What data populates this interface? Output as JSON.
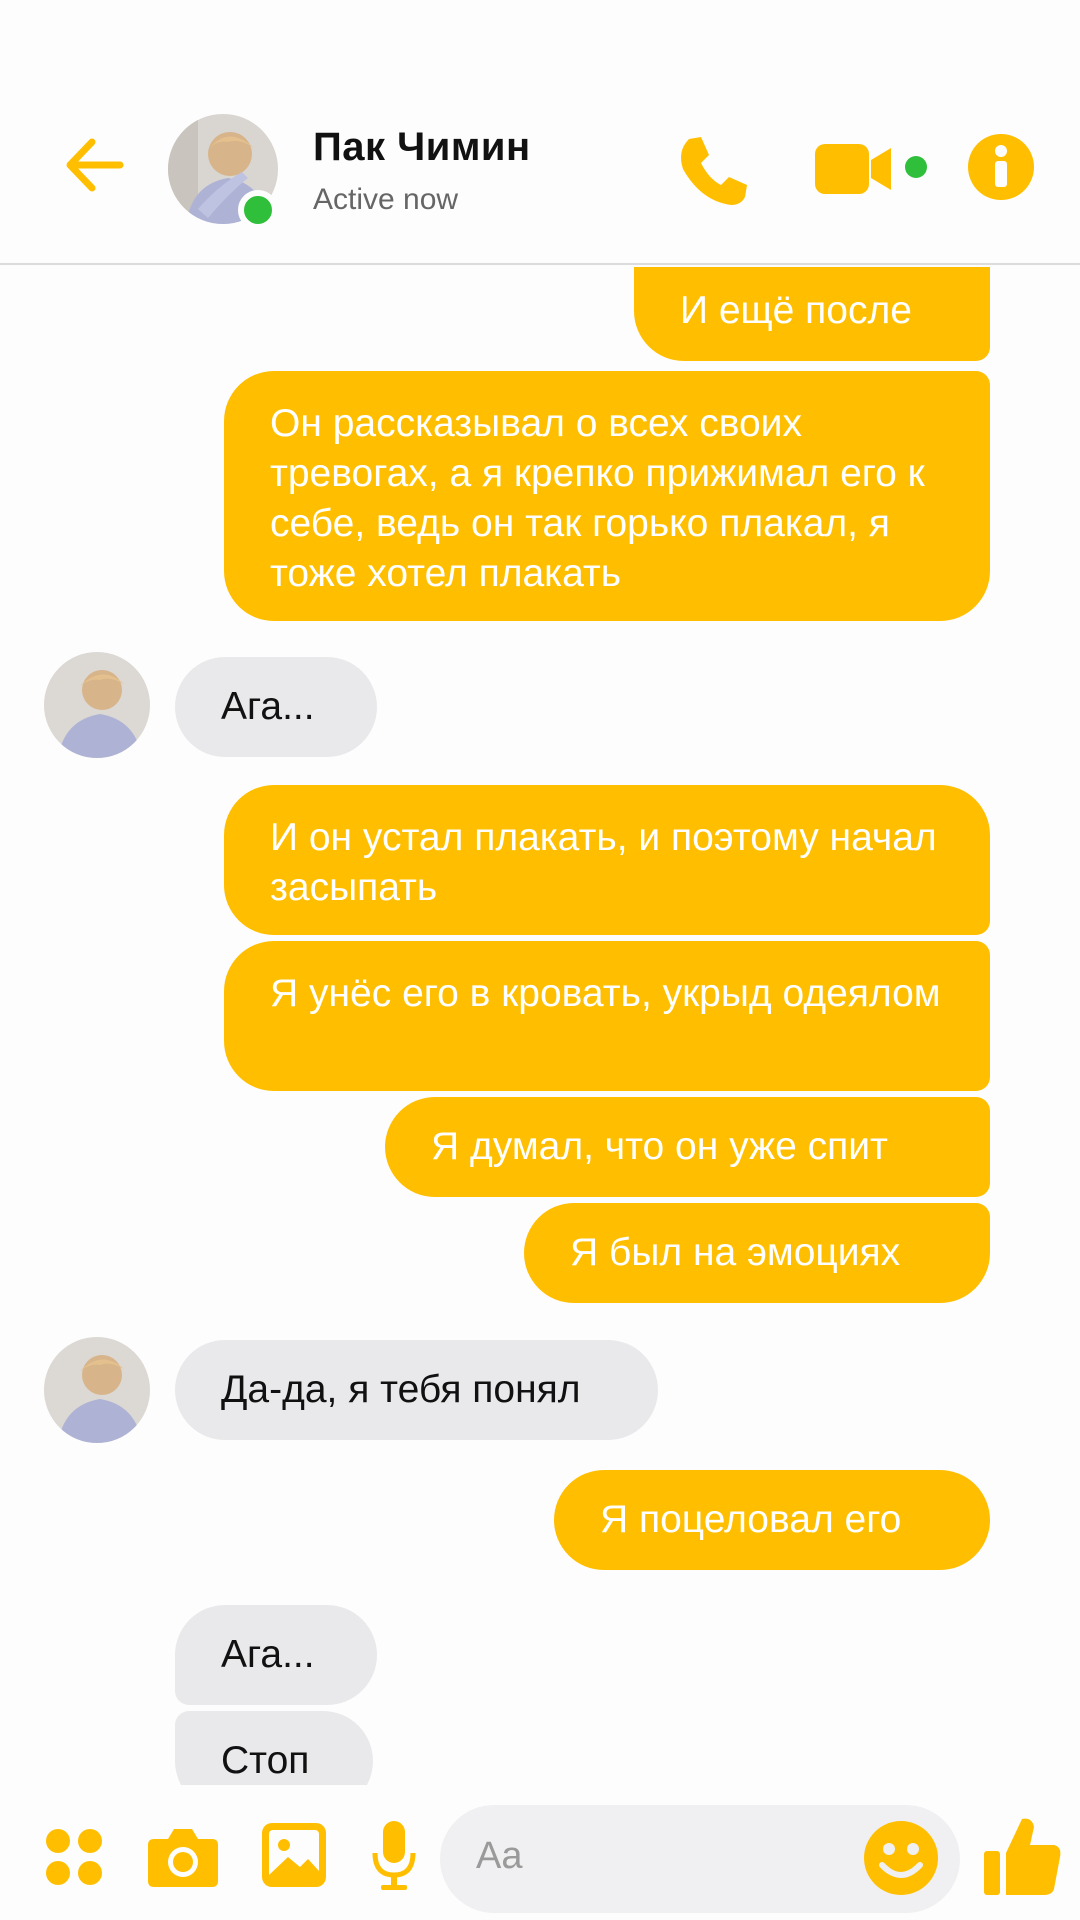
{
  "colors": {
    "accent": "#ffbf00",
    "incoming_bubble": "#e9e9ec",
    "online": "#2fbf3a"
  },
  "header": {
    "contact_name": "Пак Чимин",
    "status": "Active now",
    "icons": [
      "back-arrow-icon",
      "phone-icon",
      "video-camera-icon",
      "info-icon"
    ]
  },
  "messages": [
    {
      "dir": "out",
      "text": "И ещё после"
    },
    {
      "dir": "out",
      "text": "Он рассказывал о всех своих тревогах, а я крепко прижимал его к себе, ведь он так горько плакал, я тоже хотел плакать"
    },
    {
      "dir": "in",
      "text": "Ага..."
    },
    {
      "dir": "out",
      "text": "И он устал плакать, и поэтому начал засыпать"
    },
    {
      "dir": "out",
      "text": "Я унёс его в кровать, укрыд одеялом"
    },
    {
      "dir": "out",
      "text": "Я думал, что он уже спит"
    },
    {
      "dir": "out",
      "text": "Я был на эмоциях"
    },
    {
      "dir": "in",
      "text": "Да-да, я тебя понял"
    },
    {
      "dir": "out",
      "text": "Я поцеловал его"
    },
    {
      "dir": "in",
      "text": "Ага..."
    },
    {
      "dir": "in",
      "text": "Стоп"
    }
  ],
  "composer": {
    "placeholder": "Aa",
    "icons": [
      "apps-icon",
      "camera-icon",
      "gallery-icon",
      "microphone-icon",
      "emoji-icon",
      "thumbs-up-icon"
    ]
  }
}
